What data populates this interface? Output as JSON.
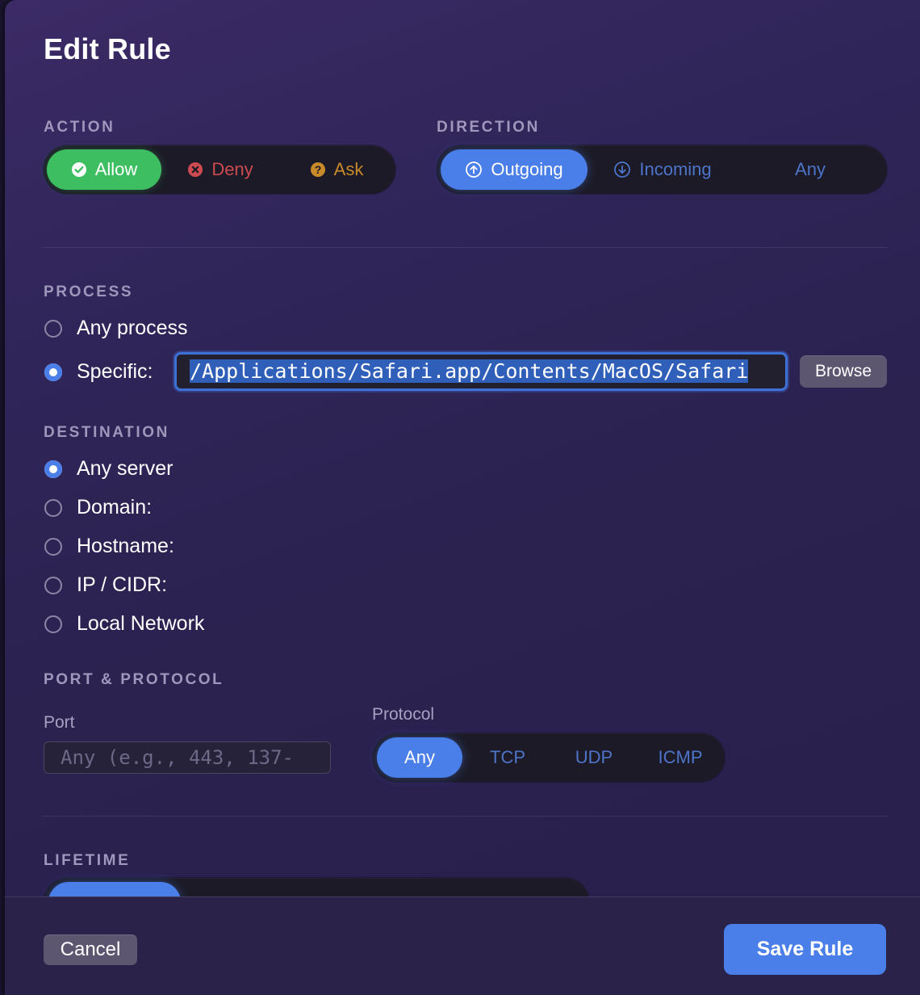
{
  "dialog": {
    "title": "Edit Rule"
  },
  "action": {
    "label": "ACTION",
    "options": [
      {
        "label": "Allow",
        "icon": "check-circle-icon",
        "selected": true
      },
      {
        "label": "Deny",
        "icon": "x-circle-icon",
        "selected": false
      },
      {
        "label": "Ask",
        "icon": "question-circle-icon",
        "selected": false
      }
    ]
  },
  "direction": {
    "label": "DIRECTION",
    "options": [
      {
        "label": "Outgoing",
        "icon": "arrow-up-circle-icon",
        "selected": true
      },
      {
        "label": "Incoming",
        "icon": "arrow-down-circle-icon",
        "selected": false
      },
      {
        "label": "Any",
        "selected": false
      }
    ]
  },
  "process": {
    "label": "PROCESS",
    "options": [
      {
        "label": "Any process",
        "selected": false
      },
      {
        "label": "Specific:",
        "selected": true
      }
    ],
    "path_value": "/Applications/Safari.app/Contents/MacOS/Safari",
    "browse_label": "Browse"
  },
  "destination": {
    "label": "DESTINATION",
    "options": [
      {
        "label": "Any server",
        "selected": true
      },
      {
        "label": "Domain:",
        "selected": false
      },
      {
        "label": "Hostname:",
        "selected": false
      },
      {
        "label": "IP / CIDR:",
        "selected": false
      },
      {
        "label": "Local Network",
        "selected": false
      }
    ]
  },
  "port_protocol": {
    "label": "PORT & PROTOCOL",
    "port_label": "Port",
    "port_placeholder": "Any (e.g., 443, 137-",
    "protocol_label": "Protocol",
    "protocols": [
      {
        "label": "Any",
        "selected": true
      },
      {
        "label": "TCP",
        "selected": false
      },
      {
        "label": "UDP",
        "selected": false
      },
      {
        "label": "ICMP",
        "selected": false
      }
    ]
  },
  "lifetime": {
    "label": "LIFETIME"
  },
  "footer": {
    "cancel_label": "Cancel",
    "save_label": "Save Rule"
  },
  "colors": {
    "accent": "#4a7ee8",
    "allow": "#3dbe61",
    "deny": "#cc4a50",
    "ask": "#c98a2a"
  }
}
